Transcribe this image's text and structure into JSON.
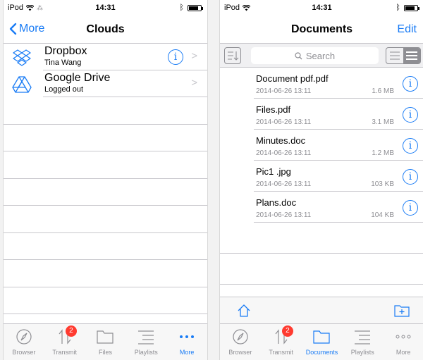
{
  "left": {
    "status": {
      "carrier": "iPod",
      "time": "14:31"
    },
    "nav": {
      "back_label": "More",
      "title": "Clouds"
    },
    "clouds": [
      {
        "name": "Dropbox",
        "sub": "Tina Wang",
        "icon": "dropbox-icon",
        "has_info": true
      },
      {
        "name": "Google Drive",
        "sub": "Logged out",
        "icon": "google-drive-icon",
        "has_info": false
      }
    ],
    "tabs": [
      {
        "label": "Browser",
        "icon": "compass-icon",
        "active": false
      },
      {
        "label": "Transmit",
        "icon": "transfer-icon",
        "badge": "2",
        "active": false
      },
      {
        "label": "Files",
        "icon": "folder-icon",
        "active": false
      },
      {
        "label": "Playlists",
        "icon": "playlist-icon",
        "active": false
      },
      {
        "label": "More",
        "icon": "more-icon",
        "active": true
      }
    ]
  },
  "right": {
    "status": {
      "carrier": "iPod",
      "time": "14:31"
    },
    "nav": {
      "title": "Documents",
      "edit_label": "Edit"
    },
    "search": {
      "placeholder": "Search"
    },
    "documents": [
      {
        "name": "Document pdf.pdf",
        "date": "2014-06-26 13:11",
        "size": "1.6 MB"
      },
      {
        "name": "Files.pdf",
        "date": "2014-06-26 13:11",
        "size": "3.1 MB"
      },
      {
        "name": "Minutes.doc",
        "date": "2014-06-26 13:11",
        "size": "1.2 MB"
      },
      {
        "name": "Pic1 .jpg",
        "date": "2014-06-26 13:11",
        "size": "103 KB"
      },
      {
        "name": "Plans.doc",
        "date": "2014-06-26 13:11",
        "size": "104 KB"
      }
    ],
    "tabs": [
      {
        "label": "Browser",
        "icon": "compass-icon",
        "active": false
      },
      {
        "label": "Transmit",
        "icon": "transfer-icon",
        "badge": "2",
        "active": false
      },
      {
        "label": "Documents",
        "icon": "folder-icon",
        "active": true
      },
      {
        "label": "Playlists",
        "icon": "playlist-icon",
        "active": false
      },
      {
        "label": "More",
        "icon": "more-icon",
        "active": false
      }
    ]
  },
  "colors": {
    "accent": "#1a7cf5",
    "badge": "#ff3b30",
    "separator": "#c8c7cc",
    "secondary_text": "#8e8e93"
  }
}
